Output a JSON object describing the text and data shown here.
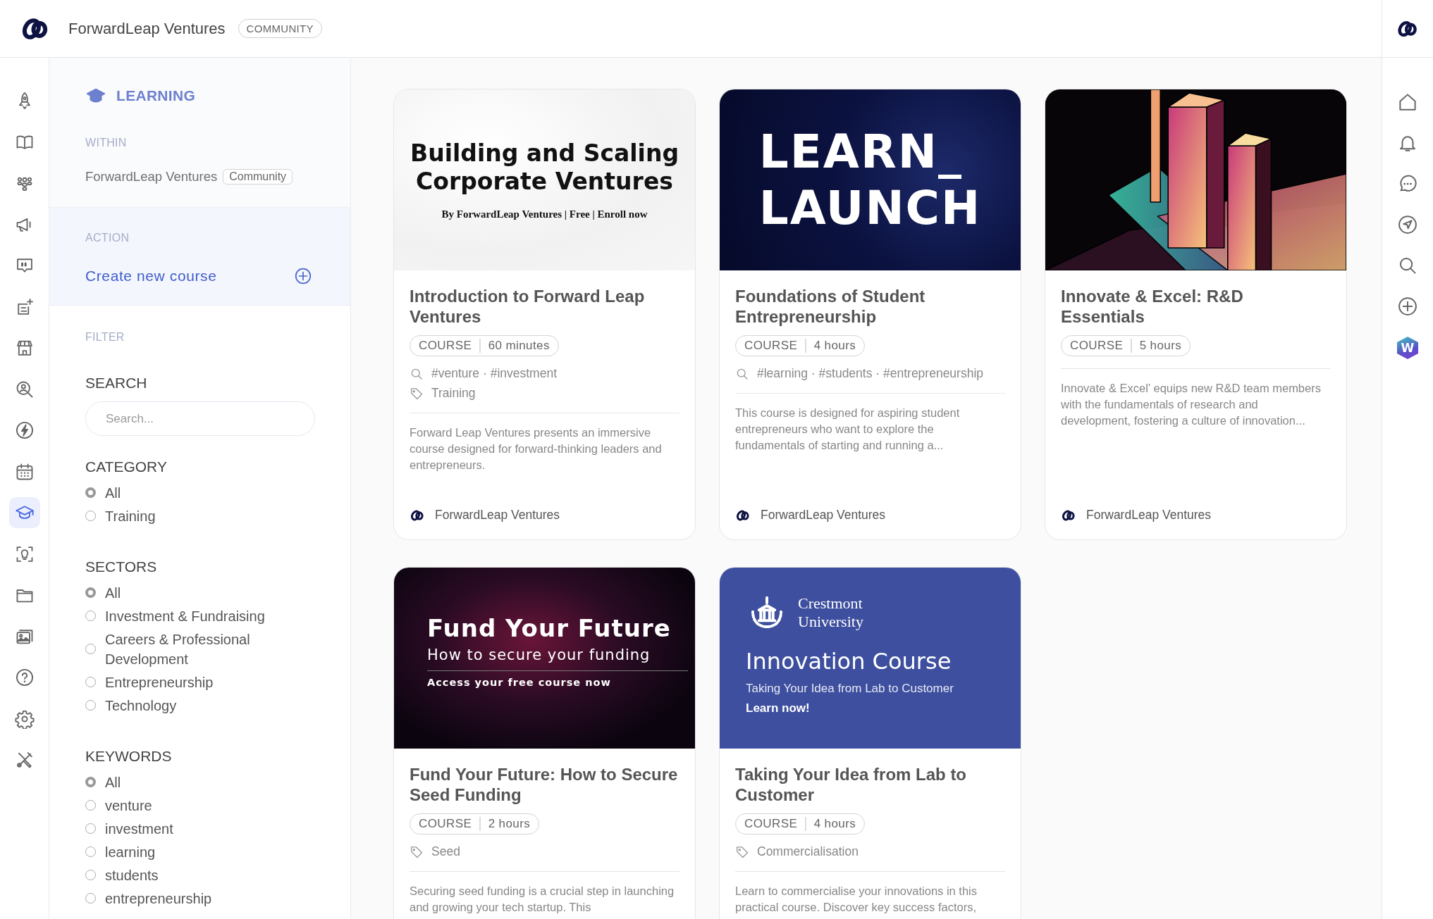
{
  "header": {
    "org_name": "ForwardLeap Ventures",
    "badge": "COMMUNITY"
  },
  "left_rail": [
    {
      "selected": false
    },
    {
      "selected": false
    },
    {
      "selected": false
    },
    {
      "selected": false
    },
    {
      "selected": false
    },
    {
      "selected": false
    },
    {
      "selected": false
    },
    {
      "selected": false
    },
    {
      "selected": false
    },
    {
      "selected": false
    },
    {
      "selected": true
    },
    {
      "selected": false
    },
    {
      "selected": false
    },
    {
      "selected": false
    },
    {
      "selected": false
    },
    {
      "selected": false
    },
    {
      "selected": false
    }
  ],
  "panel": {
    "title": "LEARNING",
    "within_label": "WITHIN",
    "within_name": "ForwardLeap Ventures",
    "within_badge": "Community",
    "action_label": "ACTION",
    "action": "Create new course",
    "filter_label": "FILTER",
    "search_label": "SEARCH",
    "search_placeholder": "Search...",
    "groups": [
      {
        "title": "CATEGORY",
        "options": [
          {
            "label": "All",
            "selected": true
          },
          {
            "label": "Training",
            "selected": false
          }
        ]
      },
      {
        "title": "SECTORS",
        "options": [
          {
            "label": "All",
            "selected": true
          },
          {
            "label": "Investment & Fundraising",
            "selected": false
          },
          {
            "label": "Careers & Professional Development",
            "selected": false
          },
          {
            "label": "Entrepreneurship",
            "selected": false
          },
          {
            "label": "Technology",
            "selected": false
          }
        ]
      },
      {
        "title": "KEYWORDS",
        "options": [
          {
            "label": "All",
            "selected": true
          },
          {
            "label": "venture",
            "selected": false
          },
          {
            "label": "investment",
            "selected": false
          },
          {
            "label": "learning",
            "selected": false
          },
          {
            "label": "students",
            "selected": false
          },
          {
            "label": "entrepreneurship",
            "selected": false
          }
        ]
      }
    ]
  },
  "courses": [
    {
      "cover": {
        "kind": "marble",
        "heading": "Building and Scaling Corporate Ventures",
        "byline": "By ForwardLeap Ventures | Free | Enroll now"
      },
      "title": "Introduction to Forward Leap Ventures",
      "type": "COURSE",
      "duration": "60 minutes",
      "keywords": "#venture · #investment",
      "category": "Training",
      "description": "Forward Leap Ventures presents an immersive course designed for forward-thinking leaders and entrepreneurs.",
      "author": "ForwardLeap Ventures"
    },
    {
      "cover": {
        "kind": "particles",
        "heading": "LEARN_ LAUNCH"
      },
      "title": "Foundations of Student Entrepreneurship",
      "type": "COURSE",
      "duration": "4 hours",
      "keywords": "#learning · #students · #entrepreneurship",
      "description": "This course is designed for aspiring student entrepreneurs who want to explore the fundamentals of starting and running a...",
      "author": "ForwardLeap Ventures"
    },
    {
      "cover": {
        "kind": "prisms"
      },
      "title": "Innovate & Excel: R&D Essentials",
      "type": "COURSE",
      "duration": "5 hours",
      "description": "Innovate & Excel’ equips new R&D team members with the fundamentals of research and development, fostering a culture of innovation...",
      "author": "ForwardLeap Ventures"
    },
    {
      "cover": {
        "kind": "dark-glow",
        "heading": "Fund Your Future",
        "subheading": "How to secure your funding",
        "byline": "Access your free course now"
      },
      "title": "Fund Your Future: How to Secure Seed Funding",
      "type": "COURSE",
      "duration": "2 hours",
      "category": "Seed",
      "description": "Securing seed funding is a crucial step in launching and growing your tech startup. This"
    },
    {
      "cover": {
        "kind": "university",
        "org": "Crestmont University",
        "heading": "Innovation Course",
        "subheading": "Taking Your Idea from Lab to Customer",
        "byline": "Learn now!"
      },
      "title": "Taking Your Idea from Lab to Customer",
      "type": "COURSE",
      "duration": "4 hours",
      "category": "Commercialisation",
      "description": "Learn to commercialise your innovations in this practical course. Discover key success factors,"
    }
  ],
  "right_rail": {
    "app_badge": "W"
  }
}
